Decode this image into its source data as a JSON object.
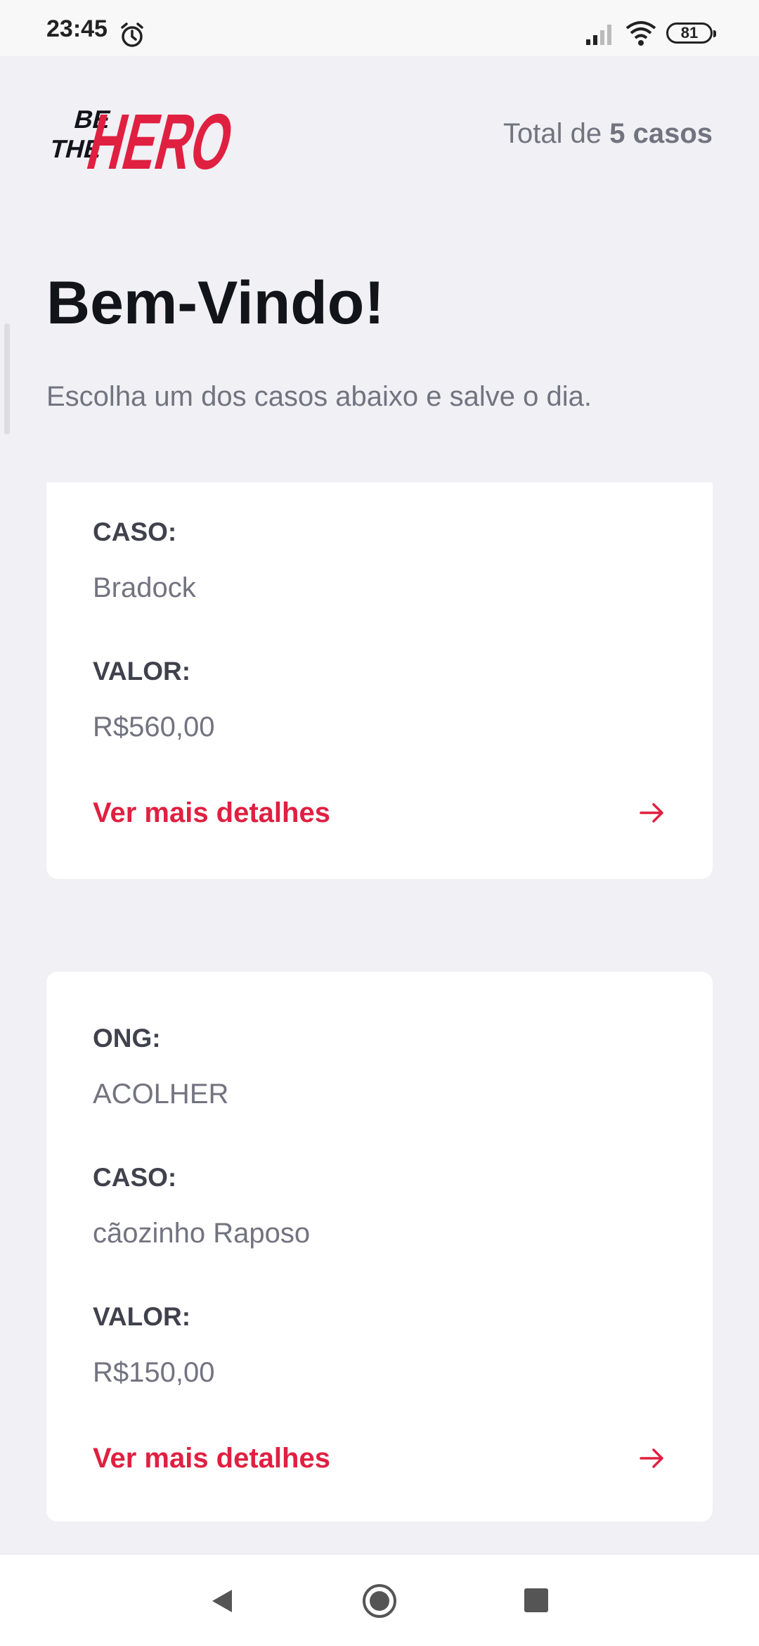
{
  "status_bar": {
    "time": "23:45",
    "battery": "81",
    "icons": [
      "alarm-icon",
      "signal-icon",
      "wifi-icon",
      "battery-icon"
    ]
  },
  "header": {
    "logo_text": [
      "BE",
      "THE",
      "HERO"
    ],
    "total_prefix": "Total de ",
    "total_value": "5 casos"
  },
  "page": {
    "title": "Bem-Vindo!",
    "subtitle": "Escolha um dos casos abaixo e salve o dia."
  },
  "cases": [
    {
      "case_label": "CASO:",
      "case_value": "Bradock",
      "value_label": "VALOR:",
      "value_value": "R$560,00",
      "details_label": "Ver mais detalhes"
    },
    {
      "ong_label": "ONG:",
      "ong_value": "ACOLHER",
      "case_label": "CASO:",
      "case_value": "cãozinho Raposo",
      "value_label": "VALOR:",
      "value_value": "R$150,00",
      "details_label": "Ver mais detalhes"
    }
  ],
  "colors": {
    "brand_red": "#e02041",
    "background": "#f0f0f5",
    "text_dark": "#13131a",
    "text_muted": "#737380"
  },
  "nav_bar": {
    "icons": [
      "back-icon",
      "home-icon",
      "recents-icon"
    ]
  }
}
